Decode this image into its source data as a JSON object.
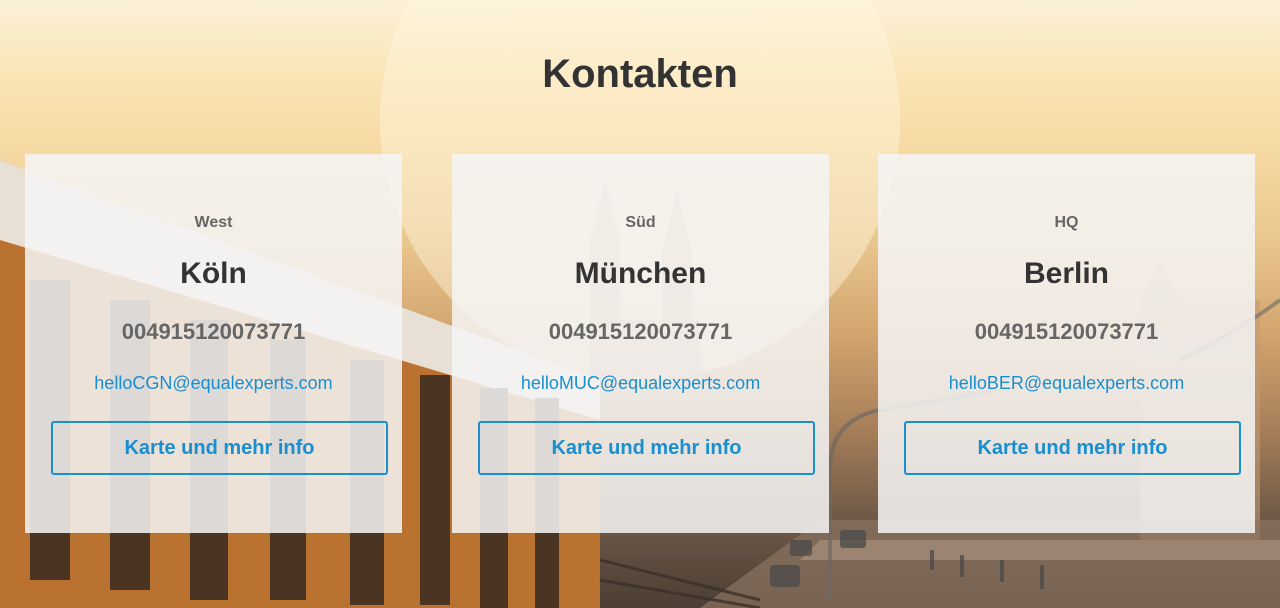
{
  "page": {
    "title": "Kontakten"
  },
  "theme": {
    "link_color": "#1a8fd0",
    "heading_color": "#333333",
    "muted_color": "#666666",
    "card_background": "rgba(244,244,244,0.86)"
  },
  "contacts": [
    {
      "region": "West",
      "city": "Köln",
      "phone": "004915120073771",
      "email": "helloCGN@equalexperts.com",
      "button_label": "Karte und mehr info"
    },
    {
      "region": "Süd",
      "city": "München",
      "phone": "004915120073771",
      "email": "helloMUC@equalexperts.com",
      "button_label": "Karte und mehr info"
    },
    {
      "region": "HQ",
      "city": "Berlin",
      "phone": "004915120073771",
      "email": "helloBER@equalexperts.com",
      "button_label": "Karte und mehr info"
    }
  ]
}
